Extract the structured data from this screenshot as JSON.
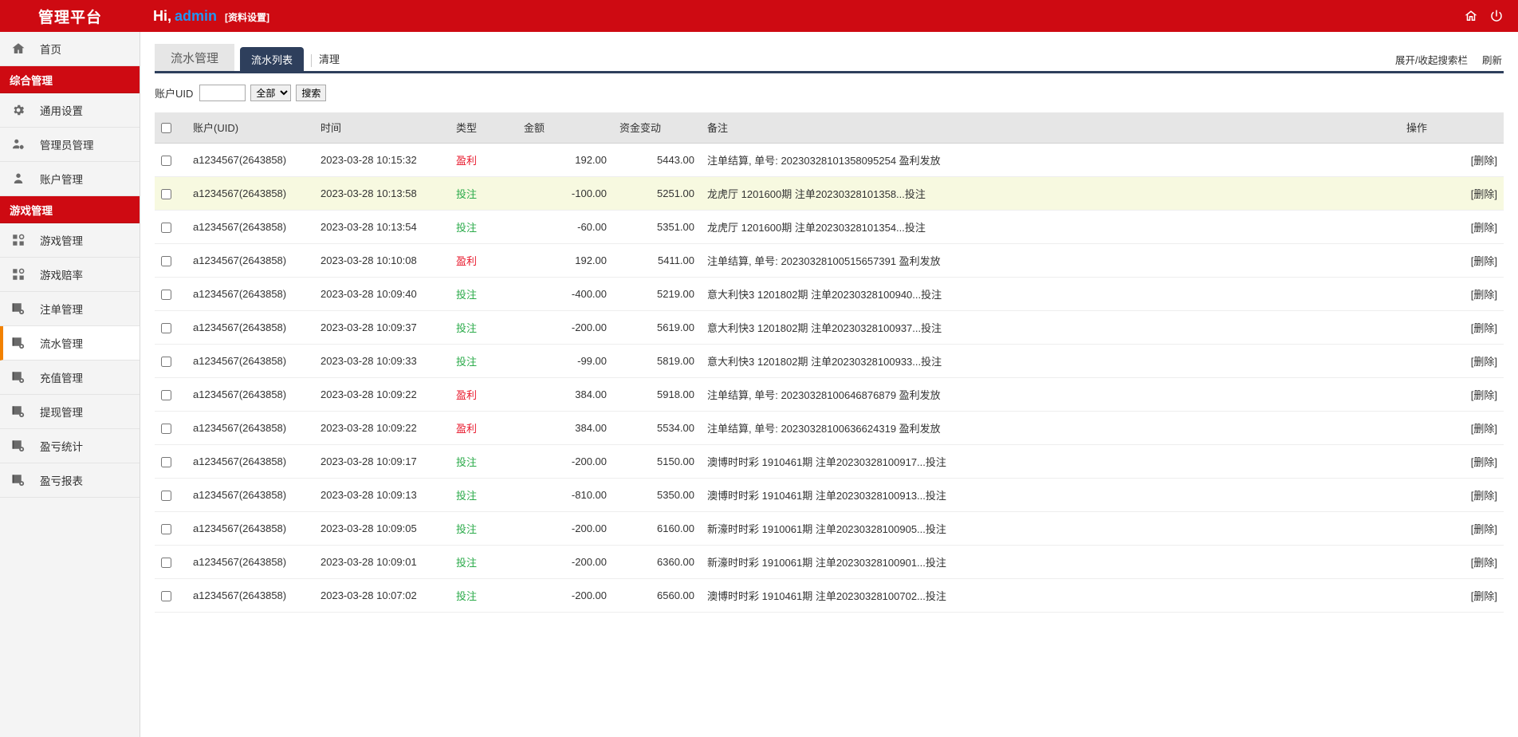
{
  "topbar": {
    "brand": "管理平台",
    "greeting_prefix": "Hi,",
    "admin_name": "admin",
    "profile_link": "[资料设置]",
    "home_icon": "home-icon",
    "power_icon": "power-icon"
  },
  "sidebar": {
    "items": [
      {
        "type": "item",
        "label": "首页",
        "icon": "home-icon",
        "active": false
      },
      {
        "type": "group",
        "label": "综合管理"
      },
      {
        "type": "item",
        "label": "通用设置",
        "icon": "gear-icon",
        "active": false
      },
      {
        "type": "item",
        "label": "管理员管理",
        "icon": "user-cog-icon",
        "active": false
      },
      {
        "type": "item",
        "label": "账户管理",
        "icon": "user-icon",
        "active": false
      },
      {
        "type": "group",
        "label": "游戏管理"
      },
      {
        "type": "item",
        "label": "游戏管理",
        "icon": "grid-icon",
        "active": false
      },
      {
        "type": "item",
        "label": "游戏赔率",
        "icon": "grid-icon",
        "active": false
      },
      {
        "type": "item",
        "label": "注单管理",
        "icon": "report-icon",
        "active": false
      },
      {
        "type": "item",
        "label": "流水管理",
        "icon": "report-icon",
        "active": true
      },
      {
        "type": "item",
        "label": "充值管理",
        "icon": "report-icon",
        "active": false
      },
      {
        "type": "item",
        "label": "提现管理",
        "icon": "report-icon",
        "active": false
      },
      {
        "type": "item",
        "label": "盈亏统计",
        "icon": "report-icon",
        "active": false
      },
      {
        "type": "item",
        "label": "盈亏报表",
        "icon": "report-icon",
        "active": false
      }
    ]
  },
  "page": {
    "section_title": "流水管理",
    "tabs": [
      {
        "label": "流水列表",
        "active": true
      }
    ],
    "links": [
      {
        "label": "清理"
      }
    ],
    "toolbar_right": [
      {
        "label": "展开/收起搜索栏"
      },
      {
        "label": "刷新"
      }
    ]
  },
  "search": {
    "uid_label": "账户UID",
    "uid_value": "",
    "uid_placeholder": "",
    "type_selected": "全部",
    "type_options": [
      "全部"
    ],
    "search_button": "搜索"
  },
  "table": {
    "columns": [
      "账户(UID)",
      "时间",
      "类型",
      "金额",
      "资金变动",
      "备注",
      "操作"
    ],
    "delete_label": "[删除]",
    "rows": [
      {
        "account": "a1234567(2643858)",
        "time": "2023-03-28 10:15:32",
        "type": "盈利",
        "type_kind": "win",
        "amount": "192.00",
        "balance": "5443.00",
        "memo": "注单结算, 单号: 20230328101358095254 盈利发放",
        "highlight": false
      },
      {
        "account": "a1234567(2643858)",
        "time": "2023-03-28 10:13:58",
        "type": "投注",
        "type_kind": "bet",
        "amount": "-100.00",
        "balance": "5251.00",
        "memo": "龙虎厅 1201600期 注单20230328101358...投注",
        "highlight": true
      },
      {
        "account": "a1234567(2643858)",
        "time": "2023-03-28 10:13:54",
        "type": "投注",
        "type_kind": "bet",
        "amount": "-60.00",
        "balance": "5351.00",
        "memo": "龙虎厅 1201600期 注单20230328101354...投注",
        "highlight": false
      },
      {
        "account": "a1234567(2643858)",
        "time": "2023-03-28 10:10:08",
        "type": "盈利",
        "type_kind": "win",
        "amount": "192.00",
        "balance": "5411.00",
        "memo": "注单结算, 单号: 20230328100515657391 盈利发放",
        "highlight": false
      },
      {
        "account": "a1234567(2643858)",
        "time": "2023-03-28 10:09:40",
        "type": "投注",
        "type_kind": "bet",
        "amount": "-400.00",
        "balance": "5219.00",
        "memo": "意大利快3 1201802期 注单20230328100940...投注",
        "highlight": false
      },
      {
        "account": "a1234567(2643858)",
        "time": "2023-03-28 10:09:37",
        "type": "投注",
        "type_kind": "bet",
        "amount": "-200.00",
        "balance": "5619.00",
        "memo": "意大利快3 1201802期 注单20230328100937...投注",
        "highlight": false
      },
      {
        "account": "a1234567(2643858)",
        "time": "2023-03-28 10:09:33",
        "type": "投注",
        "type_kind": "bet",
        "amount": "-99.00",
        "balance": "5819.00",
        "memo": "意大利快3 1201802期 注单20230328100933...投注",
        "highlight": false
      },
      {
        "account": "a1234567(2643858)",
        "time": "2023-03-28 10:09:22",
        "type": "盈利",
        "type_kind": "win",
        "amount": "384.00",
        "balance": "5918.00",
        "memo": "注单结算, 单号: 20230328100646876879 盈利发放",
        "highlight": false
      },
      {
        "account": "a1234567(2643858)",
        "time": "2023-03-28 10:09:22",
        "type": "盈利",
        "type_kind": "win",
        "amount": "384.00",
        "balance": "5534.00",
        "memo": "注单结算, 单号: 20230328100636624319 盈利发放",
        "highlight": false
      },
      {
        "account": "a1234567(2643858)",
        "time": "2023-03-28 10:09:17",
        "type": "投注",
        "type_kind": "bet",
        "amount": "-200.00",
        "balance": "5150.00",
        "memo": "澳博时时彩 1910461期 注单20230328100917...投注",
        "highlight": false
      },
      {
        "account": "a1234567(2643858)",
        "time": "2023-03-28 10:09:13",
        "type": "投注",
        "type_kind": "bet",
        "amount": "-810.00",
        "balance": "5350.00",
        "memo": "澳博时时彩 1910461期 注单20230328100913...投注",
        "highlight": false
      },
      {
        "account": "a1234567(2643858)",
        "time": "2023-03-28 10:09:05",
        "type": "投注",
        "type_kind": "bet",
        "amount": "-200.00",
        "balance": "6160.00",
        "memo": "新濠时时彩 1910061期 注单20230328100905...投注",
        "highlight": false
      },
      {
        "account": "a1234567(2643858)",
        "time": "2023-03-28 10:09:01",
        "type": "投注",
        "type_kind": "bet",
        "amount": "-200.00",
        "balance": "6360.00",
        "memo": "新濠时时彩 1910061期 注单20230328100901...投注",
        "highlight": false
      },
      {
        "account": "a1234567(2643858)",
        "time": "2023-03-28 10:07:02",
        "type": "投注",
        "type_kind": "bet",
        "amount": "-200.00",
        "balance": "6560.00",
        "memo": "澳博时时彩 1910461期 注单20230328100702...投注",
        "highlight": false
      }
    ]
  },
  "colors": {
    "brand_red": "#ce0a12",
    "tab_navy": "#2e3f5c",
    "active_orange": "#f28100",
    "win_red": "#e8192c",
    "bet_green": "#2bab4a",
    "highlight_row": "#f7f9e0",
    "admin_blue": "#2196f3"
  }
}
